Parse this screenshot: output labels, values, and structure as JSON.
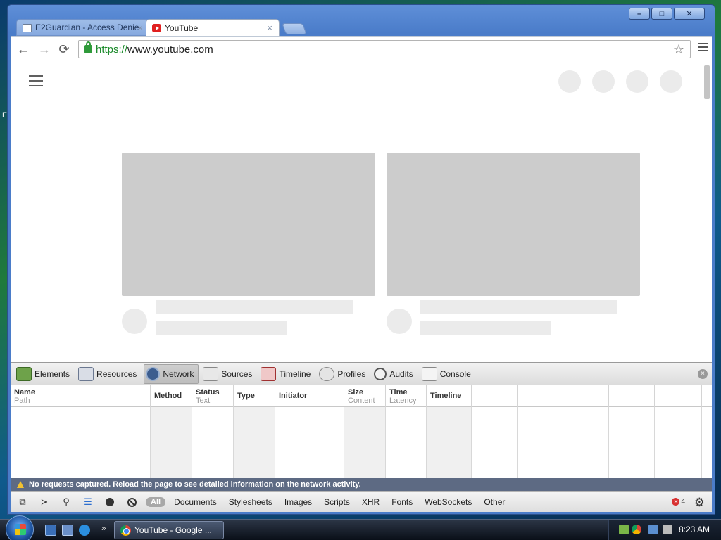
{
  "desktop": {
    "edge_letter": "F"
  },
  "window": {
    "controls": {
      "minimize": "–",
      "maximize": "□",
      "close": "✕"
    }
  },
  "tabs": [
    {
      "title": "E2Guardian - Access Denie",
      "close": "×",
      "active": false
    },
    {
      "title": "YouTube",
      "close": "×",
      "active": true
    }
  ],
  "toolbar": {
    "back": "←",
    "forward": "→",
    "reload": "⟳",
    "url_scheme": "https://",
    "url_rest": "www.youtube.com",
    "star": "☆"
  },
  "devtools": {
    "close": "×",
    "tabs": [
      {
        "label": "Elements",
        "icon": "elements-icon"
      },
      {
        "label": "Resources",
        "icon": "resources-icon"
      },
      {
        "label": "Network",
        "icon": "network-icon",
        "selected": true
      },
      {
        "label": "Sources",
        "icon": "sources-icon"
      },
      {
        "label": "Timeline",
        "icon": "timeline-icon"
      },
      {
        "label": "Profiles",
        "icon": "profiles-icon"
      },
      {
        "label": "Audits",
        "icon": "audits-icon"
      },
      {
        "label": "Console",
        "icon": "console-icon"
      }
    ],
    "columns": [
      {
        "title": "Name",
        "sub": "Path"
      },
      {
        "title": "Method",
        "sub": ""
      },
      {
        "title": "Status",
        "sub": "Text"
      },
      {
        "title": "Type",
        "sub": ""
      },
      {
        "title": "Initiator",
        "sub": ""
      },
      {
        "title": "Size",
        "sub": "Content"
      },
      {
        "title": "Time",
        "sub": "Latency"
      },
      {
        "title": "Timeline",
        "sub": ""
      }
    ],
    "warning": "No requests captured. Reload the page to see detailed information on the network activity.",
    "filters": {
      "all": "All",
      "items": [
        "Documents",
        "Stylesheets",
        "Images",
        "Scripts",
        "XHR",
        "Fonts",
        "WebSockets",
        "Other"
      ]
    },
    "error_count": "4"
  },
  "taskbar": {
    "quick_more": "»",
    "task_label": "YouTube - Google ...",
    "clock": "8:23 AM"
  }
}
